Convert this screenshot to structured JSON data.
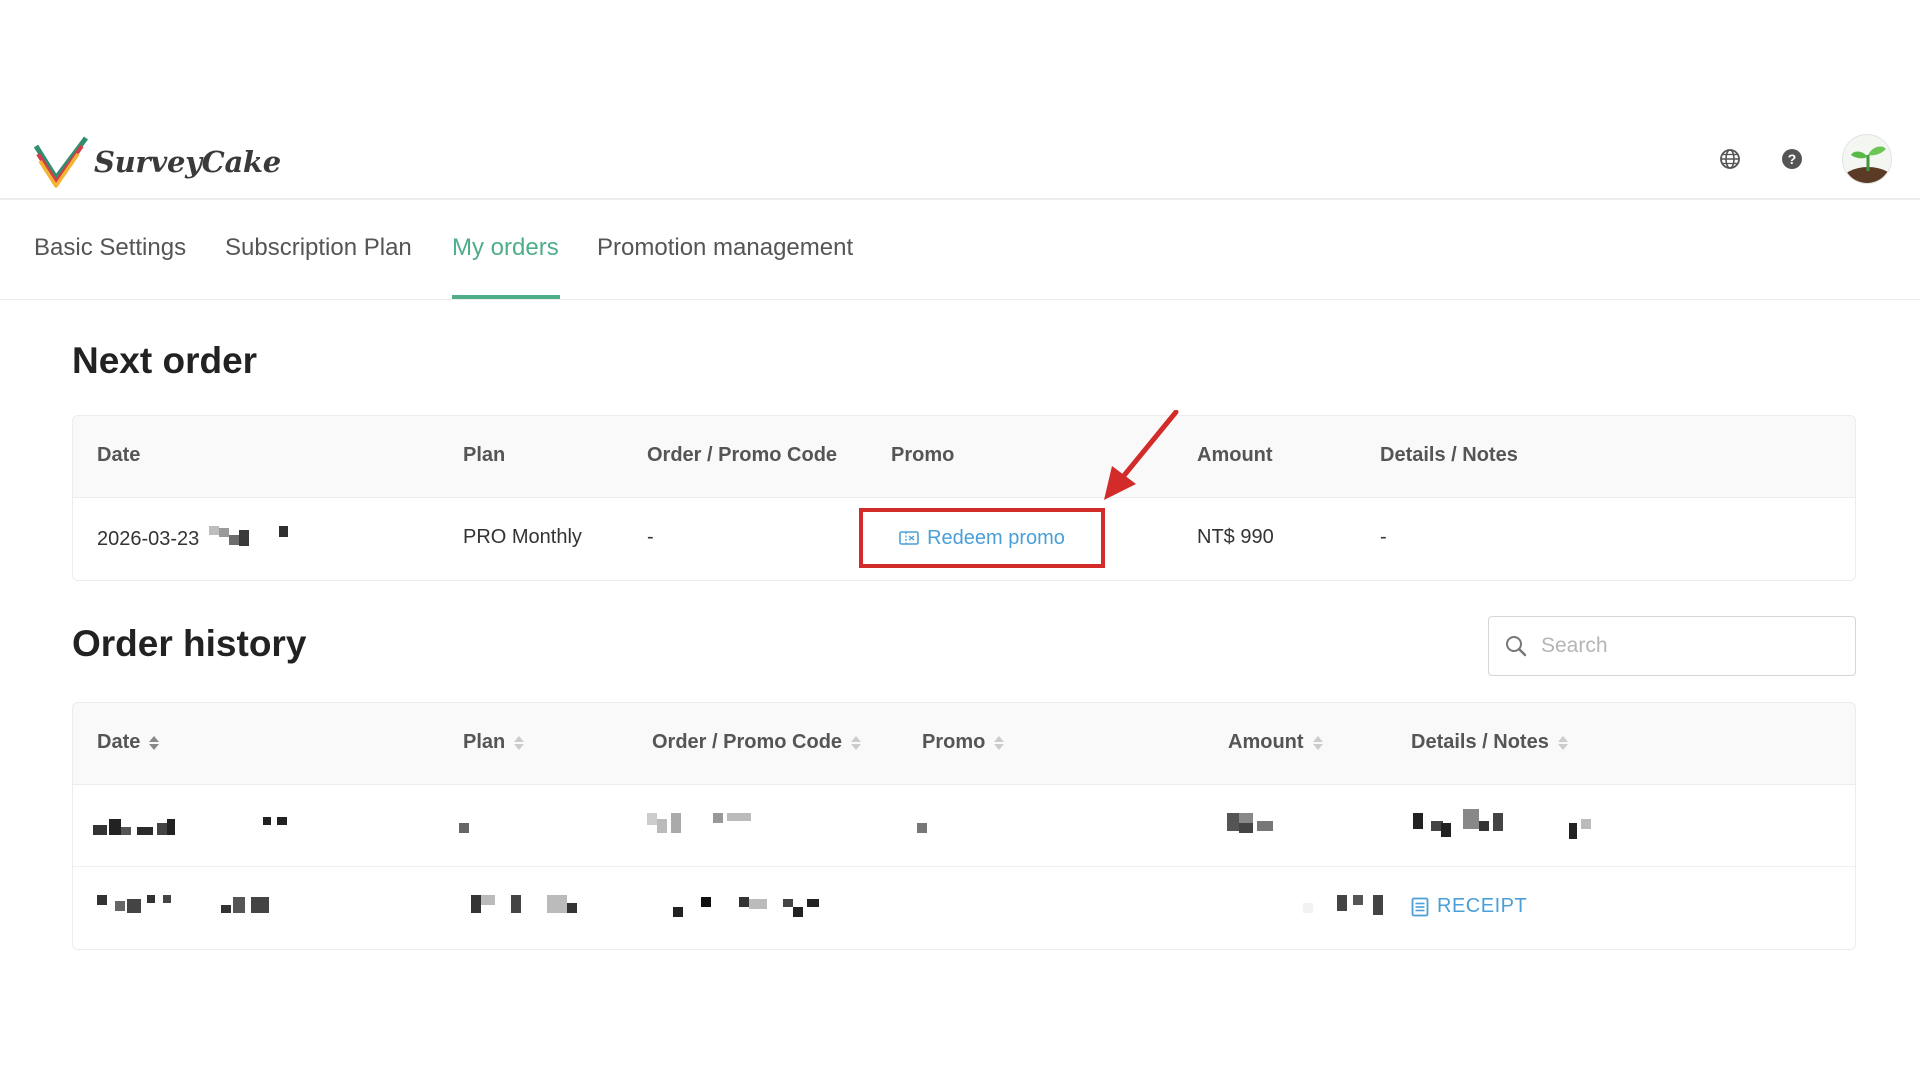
{
  "header": {
    "brand": "SurveyCake",
    "icons": [
      "globe-icon",
      "help-icon"
    ],
    "avatar_icon": "seedling-avatar"
  },
  "tabs": [
    {
      "label": "Basic Settings",
      "active": false
    },
    {
      "label": "Subscription Plan",
      "active": false
    },
    {
      "label": "My orders",
      "active": true
    },
    {
      "label": "Promotion management",
      "active": false
    }
  ],
  "next_order": {
    "title": "Next order",
    "columns": [
      "Date",
      "Plan",
      "Order / Promo Code",
      "Promo",
      "Amount",
      "Details / Notes"
    ],
    "row": {
      "date": "2026-03-23",
      "plan": "PRO Monthly",
      "code": "-",
      "promo_action": "Redeem promo",
      "amount": "NT$ 990",
      "notes": "-"
    }
  },
  "order_history": {
    "title": "Order history",
    "search_placeholder": "Search",
    "columns": [
      "Date",
      "Plan",
      "Order / Promo Code",
      "Promo",
      "Amount",
      "Details / Notes"
    ],
    "rows": [
      {
        "redacted": true
      },
      {
        "redacted": true,
        "notes_action": "RECEIPT"
      }
    ]
  },
  "colors": {
    "accent": "#4fae8a",
    "link": "#4a9fd8",
    "highlight": "#d32a2a"
  }
}
